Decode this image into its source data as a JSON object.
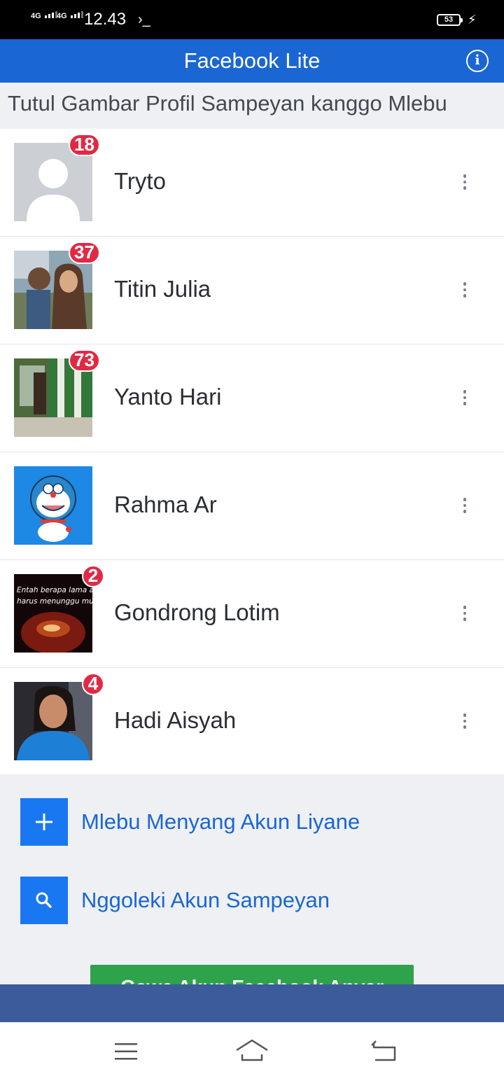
{
  "status_bar": {
    "network_1": "4G",
    "network_2": "4G",
    "time": "12.43",
    "terminal_glyph": "›_",
    "battery_level": "53",
    "battery_percent": 53,
    "charging": true
  },
  "app_bar": {
    "title": "Facebook Lite",
    "info_icon": "info-circle-icon"
  },
  "prompt": "Tutul Gambar Profil Sampeyan kanggo Mlebu",
  "accounts": [
    {
      "name": "Tryto",
      "badge": "18",
      "avatar": "default-silhouette",
      "menu_icon": "more-vertical-icon"
    },
    {
      "name": "Titin Julia",
      "badge": "37",
      "avatar": "photo-two-people",
      "menu_icon": "more-vertical-icon"
    },
    {
      "name": "Yanto Hari",
      "badge": "73",
      "avatar": "photo-room-interior",
      "menu_icon": "more-vertical-icon"
    },
    {
      "name": "Rahma Ar",
      "badge": "",
      "avatar": "doraemon-cartoon",
      "menu_icon": "more-vertical-icon"
    },
    {
      "name": "Gondrong Lotim",
      "badge": "2",
      "avatar": "dark-quote-image",
      "avatar_text": "Entah berapa lama aku harus menunggu mu...",
      "menu_icon": "more-vertical-icon"
    },
    {
      "name": "Hadi Aisyah",
      "badge": "4",
      "avatar": "selfie-photo",
      "menu_icon": "more-vertical-icon"
    }
  ],
  "actions": {
    "login_other": {
      "label": "Mlebu Menyang Akun Liyane",
      "icon": "plus-icon"
    },
    "find_account": {
      "label": "Nggoleki Akun Sampeyan",
      "icon": "search-icon"
    },
    "create_account": {
      "label": "Gawe Akun Facebook Anyar"
    }
  },
  "nav_bar": {
    "menu_icon": "menu-lines-icon",
    "home_icon": "home-icon",
    "back_icon": "back-icon"
  },
  "colors": {
    "app_bar": "#1a66d2",
    "badge": "#e02a45",
    "action_icon_bg": "#1a77f2",
    "link_text": "#1a66d2",
    "create_button": "#2fa24c",
    "language_bar": "#3b5b9a",
    "grey_bg": "#eef0f4"
  }
}
